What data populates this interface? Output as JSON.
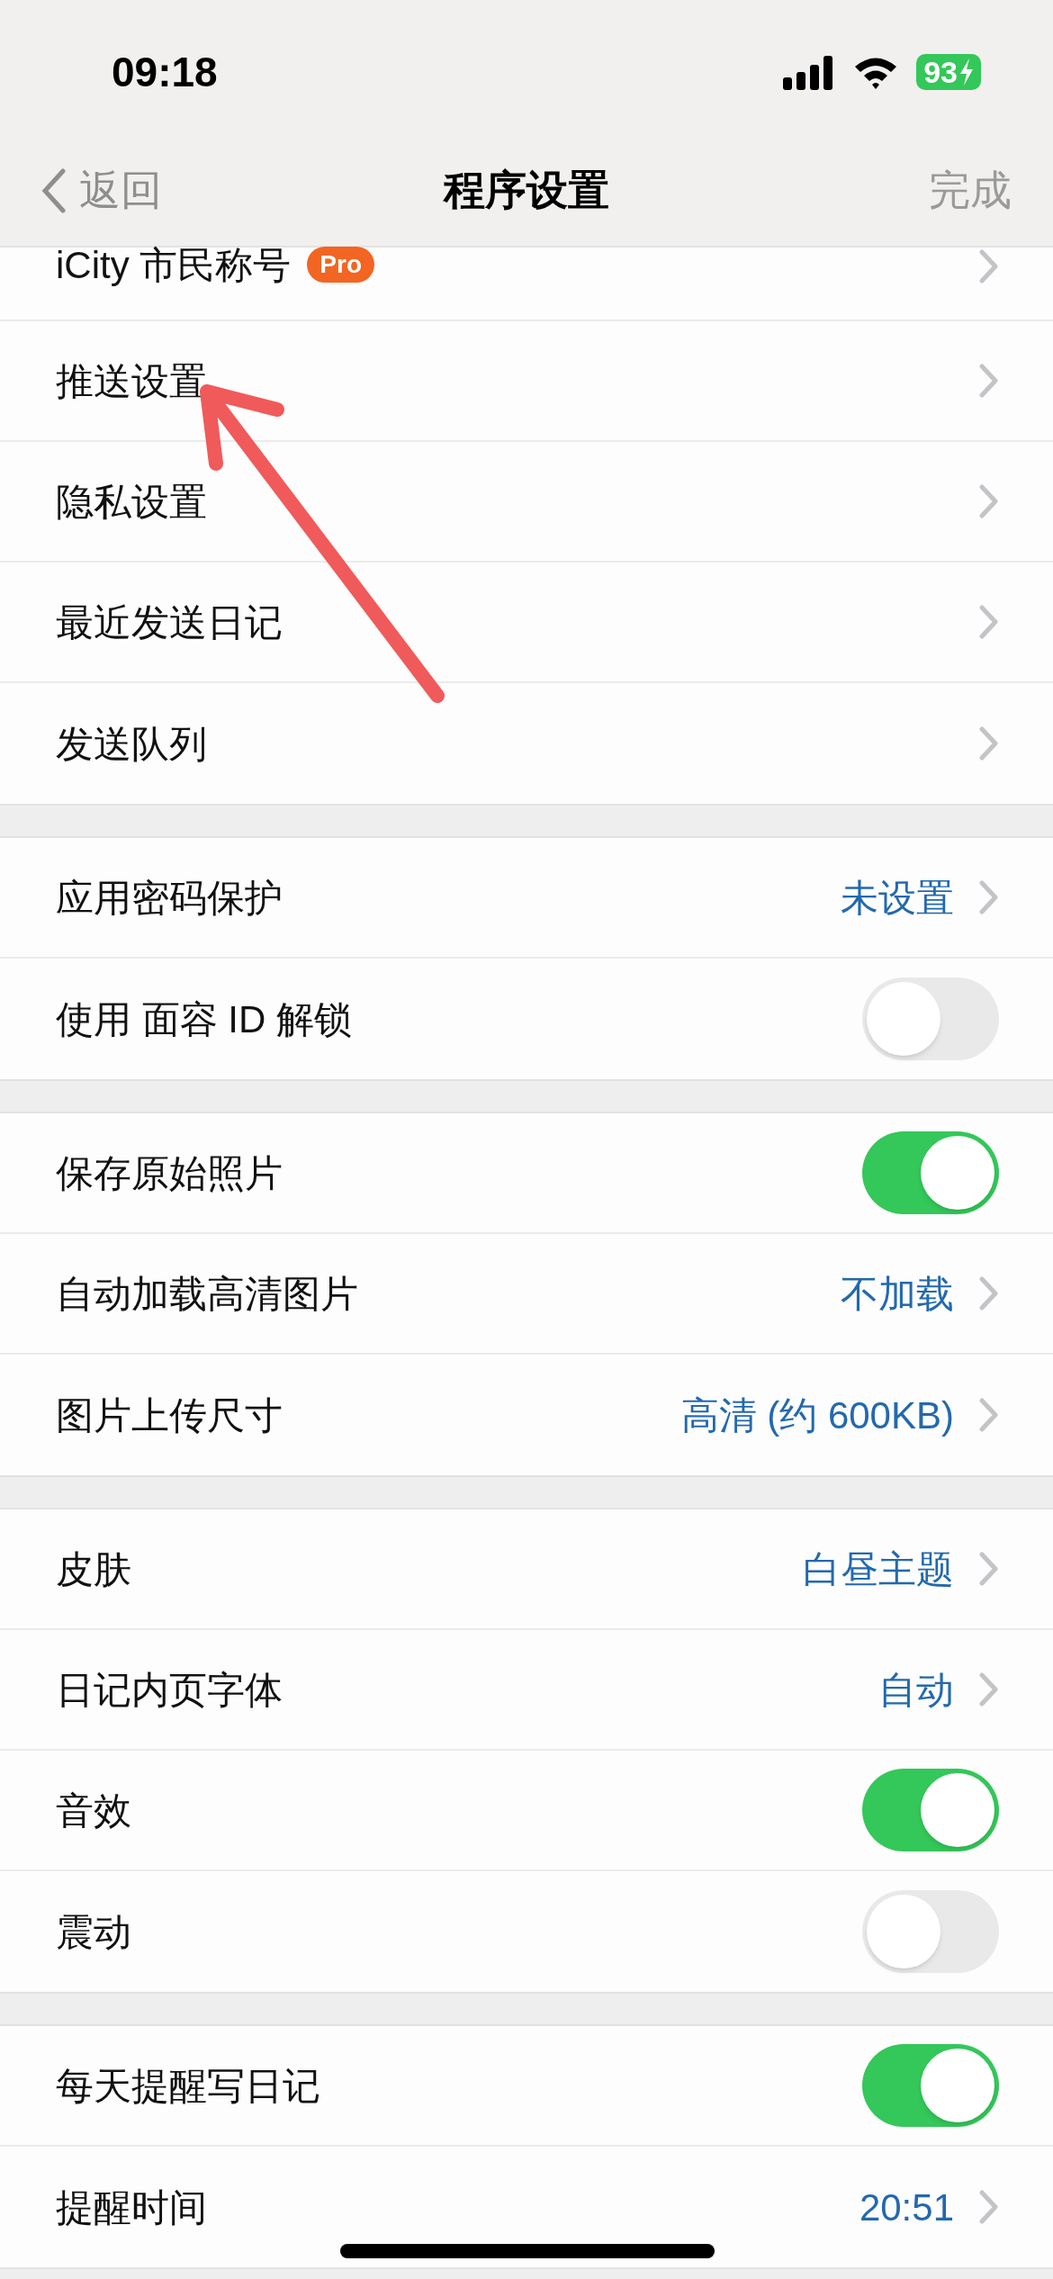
{
  "status_bar": {
    "time": "09:18",
    "battery": "93"
  },
  "nav": {
    "back": "返回",
    "title": "程序设置",
    "done": "完成"
  },
  "groups": [
    {
      "rows": [
        {
          "kind": "link",
          "label": "iCity 市民称号",
          "badge": "Pro"
        },
        {
          "kind": "link",
          "label": "推送设置"
        },
        {
          "kind": "link",
          "label": "隐私设置"
        },
        {
          "kind": "link",
          "label": "最近发送日记"
        },
        {
          "kind": "link",
          "label": "发送队列"
        }
      ]
    },
    {
      "rows": [
        {
          "kind": "link",
          "label": "应用密码保护",
          "value": "未设置"
        },
        {
          "kind": "toggle",
          "label": "使用 面容 ID 解锁",
          "on": false
        }
      ]
    },
    {
      "rows": [
        {
          "kind": "toggle",
          "label": "保存原始照片",
          "on": true
        },
        {
          "kind": "link",
          "label": "自动加载高清图片",
          "value": "不加载"
        },
        {
          "kind": "link",
          "label": "图片上传尺寸",
          "value": "高清 (约 600KB)"
        }
      ]
    },
    {
      "rows": [
        {
          "kind": "link",
          "label": "皮肤",
          "value": "白昼主题"
        },
        {
          "kind": "link",
          "label": "日记内页字体",
          "value": "自动"
        },
        {
          "kind": "toggle",
          "label": "音效",
          "on": true
        },
        {
          "kind": "toggle",
          "label": "震动",
          "on": false
        }
      ]
    },
    {
      "rows": [
        {
          "kind": "toggle",
          "label": "每天提醒写日记",
          "on": true
        },
        {
          "kind": "link",
          "label": "提醒时间",
          "value": "20:51"
        }
      ]
    }
  ]
}
